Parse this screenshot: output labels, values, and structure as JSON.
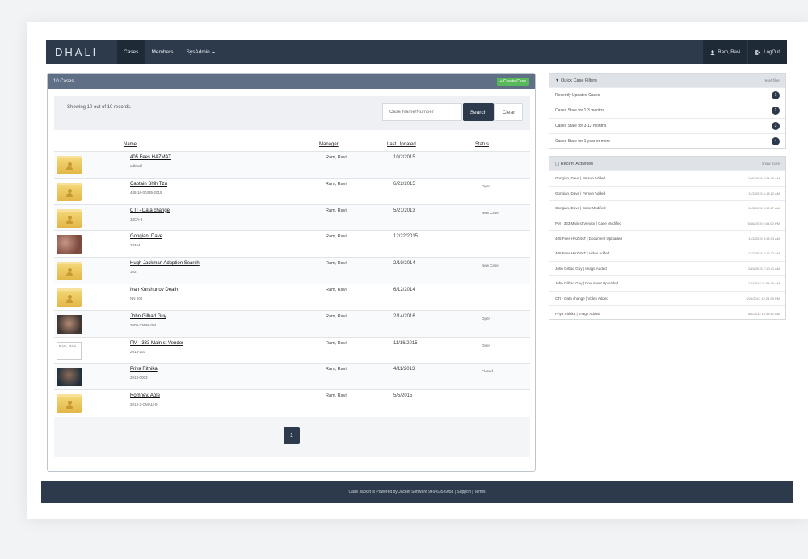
{
  "brand": "DHALI",
  "nav": [
    {
      "label": "Cases"
    },
    {
      "label": "Members"
    },
    {
      "label": "SysAdmin"
    }
  ],
  "user": {
    "name": "Ram, Ravi",
    "logout": "LogOut"
  },
  "cases_panel": {
    "title": "10 Cases",
    "create_label": "+ Create Case",
    "showing_text": "Showing 10 out of 10 records.",
    "search_placeholder": "Case Name/Number",
    "search_label": "Search",
    "clear_label": "Clear",
    "columns": {
      "name": "Name",
      "manager": "Manager",
      "updated": "Last Updated",
      "status": "Status"
    },
    "rows": [
      {
        "thumb": "folder",
        "name": "405 Fees HAZMAT",
        "number": "adfasdf",
        "manager": "Ram, Ravi",
        "updated": "10/2/2015",
        "status": ""
      },
      {
        "thumb": "folder",
        "name": "Captain Shih Tzu",
        "number": "488-16-00335-2015",
        "manager": "Ram, Ravi",
        "updated": "6/22/2015",
        "status": "Open"
      },
      {
        "thumb": "folder",
        "name": "CTI - Data change",
        "number": "33CA-9",
        "manager": "Ram, Ravi",
        "updated": "5/21/2013",
        "status": "New Case"
      },
      {
        "thumb": "photo-a",
        "name": "Gongian, Dave",
        "number": "33454",
        "manager": "Ram, Ravi",
        "updated": "12/22/2015",
        "status": ""
      },
      {
        "thumb": "folder",
        "name": "Hugh Jackman Adoption Search",
        "number": "103",
        "manager": "Ram, Ravi",
        "updated": "2/19/2014",
        "status": "New Case"
      },
      {
        "thumb": "folder",
        "name": "Ivan Kurshunov Death",
        "number": "NN 200",
        "manager": "Ram, Ravi",
        "updated": "6/12/2014",
        "status": ""
      },
      {
        "thumb": "photo-b",
        "name": "John Gilbad Guy",
        "number": "2009-33699-001",
        "manager": "Ram, Ravi",
        "updated": "2/14/2016",
        "status": "Open"
      },
      {
        "thumb": "broken",
        "thumb_text": "Ram, Ravi",
        "name": "PM - 333 Main st Vendor",
        "number": "2013-203",
        "manager": "Ram, Ravi",
        "updated": "11/16/2015",
        "status": "Open"
      },
      {
        "thumb": "photo-c",
        "name": "Priya Rithika",
        "number": "2013-0003",
        "manager": "Ram, Ravi",
        "updated": "4/11/2013",
        "status": "Closed"
      },
      {
        "thumb": "folder",
        "name": "Romney, Able",
        "number": "2013-2-OMALI-9",
        "manager": "Ram, Ravi",
        "updated": "5/5/2015",
        "status": ""
      }
    ],
    "page": "1"
  },
  "quick_filters": {
    "title": "Quick Case Filters",
    "reset": "reset filter",
    "items": [
      {
        "label": "Recently Updated Cases",
        "count": "1"
      },
      {
        "label": "Cases Stale for 1-3 months",
        "count": "2"
      },
      {
        "label": "Cases Stale for 3-12 months",
        "count": "3"
      },
      {
        "label": "Cases Stale for 1 year or more",
        "count": "4"
      }
    ]
  },
  "recent_activities": {
    "title": "Recent Activities",
    "show_more": "show more",
    "items": [
      {
        "text": "Gongian, Dave | Person Added",
        "time": "10/6/2016 6:24:00 AM"
      },
      {
        "text": "Gongian, Dave | Person Added",
        "time": "11/2/2015 6:13:22 AM"
      },
      {
        "text": "Gongian, Dave | Case Modified",
        "time": "11/2/2015 6:10:27 AM"
      },
      {
        "text": "PM - 333 Main st Vendor | Case Modified",
        "time": "6/16/2015 5:44:00 PM"
      },
      {
        "text": "405 Fees HAZMAT | Document Uploaded",
        "time": "11/2/2015 8:13:33 AM"
      },
      {
        "text": "405 Fees HAZMAT | Video Added",
        "time": "11/2/2015 6:12:27 AM"
      },
      {
        "text": "John Gilbad Guy | Image Added",
        "time": "1/15/2015 7:10:41 AM"
      },
      {
        "text": "John Gilbad Guy | Document Uploaded",
        "time": "1/6/2015 11:53:26 AM"
      },
      {
        "text": "CTI - Data change | Video Added",
        "time": "3/21/2013 12:24:39 PM"
      },
      {
        "text": "Priya Rithika | Image Added",
        "time": "5/6/2013 10:33:52 AM"
      }
    ]
  },
  "footer": "Case Jacket is Powered by Jacket Software 949-635-6058 | Support | Terms"
}
